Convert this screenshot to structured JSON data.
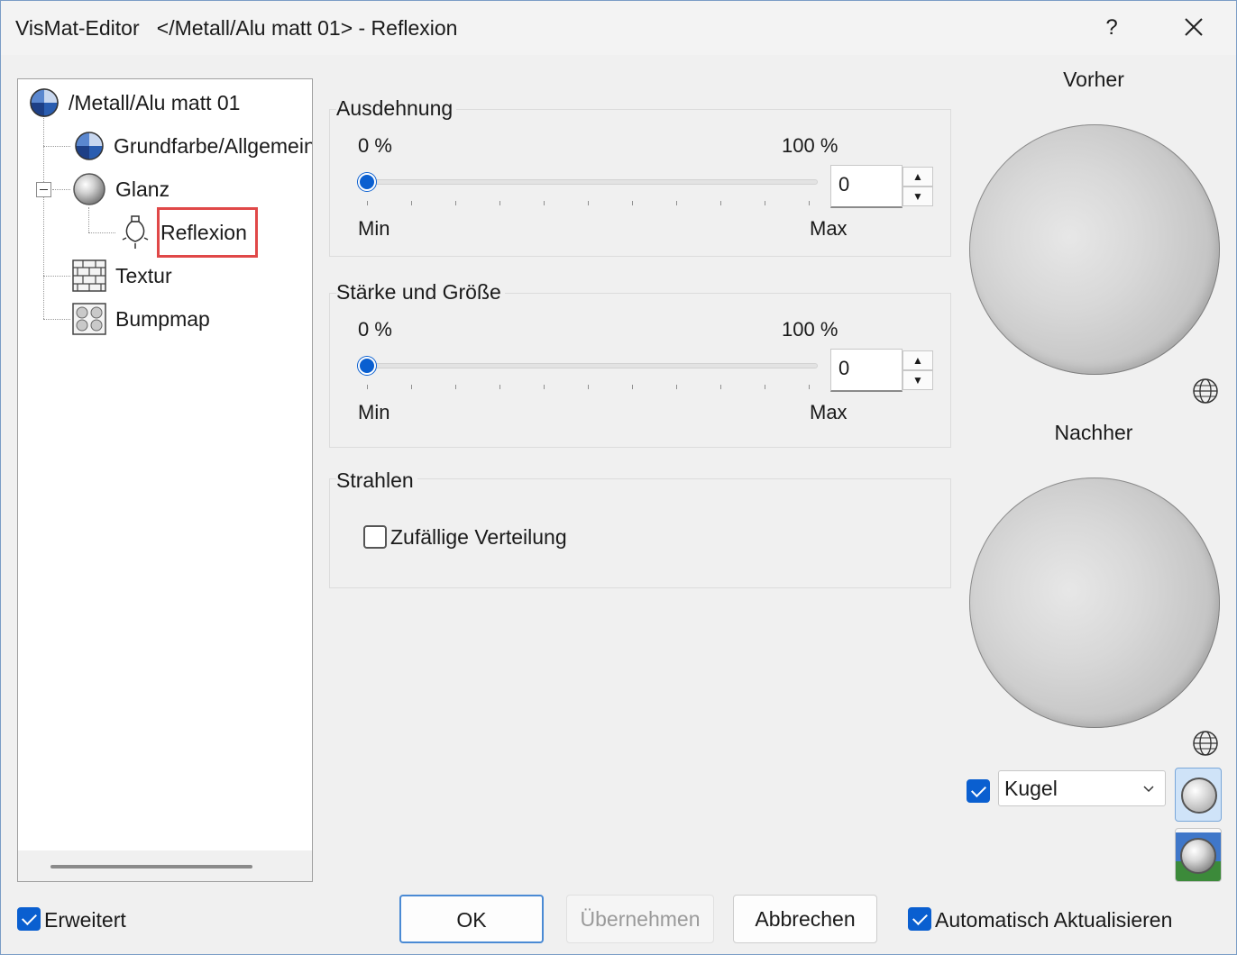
{
  "window": {
    "title": "VisMat-Editor   </Metall/Alu matt 01> - Reflexion",
    "help": "?"
  },
  "tree": {
    "items": [
      {
        "label": "/Metall/Alu matt 01",
        "icon": "material-pie-icon"
      },
      {
        "label": "Grundfarbe/Allgemein",
        "icon": "material-pie-icon"
      },
      {
        "label": "Glanz",
        "icon": "gloss-sphere-icon"
      },
      {
        "label": "Reflexion",
        "icon": "lightbulb-icon",
        "selected": true
      },
      {
        "label": "Textur",
        "icon": "brick-texture-icon"
      },
      {
        "label": "Bumpmap",
        "icon": "bumpmap-icon"
      }
    ]
  },
  "ausdehnung": {
    "title": "Ausdehnung",
    "min_pct": "0 %",
    "max_pct": "100 %",
    "min_label": "Min",
    "max_label": "Max",
    "value": "0",
    "slider_fraction": 0
  },
  "staerke": {
    "title": "Stärke und Größe",
    "min_pct": "0 %",
    "max_pct": "100 %",
    "min_label": "Min",
    "max_label": "Max",
    "value": "0",
    "slider_fraction": 0
  },
  "strahlen": {
    "title": "Strahlen",
    "random_label": "Zufällige Verteilung",
    "random_checked": false
  },
  "preview": {
    "before_label": "Vorher",
    "after_label": "Nachher",
    "shape_checked": true,
    "shape_value": "Kugel"
  },
  "footer": {
    "advanced_label": "Erweitert",
    "advanced_checked": true,
    "ok": "OK",
    "apply": "Übernehmen",
    "cancel": "Abbrechen",
    "auto_update_label": "Automatisch Aktualisieren",
    "auto_update_checked": true
  },
  "colors": {
    "accent": "#0a5fd0",
    "selection_outline": "#e04848"
  }
}
